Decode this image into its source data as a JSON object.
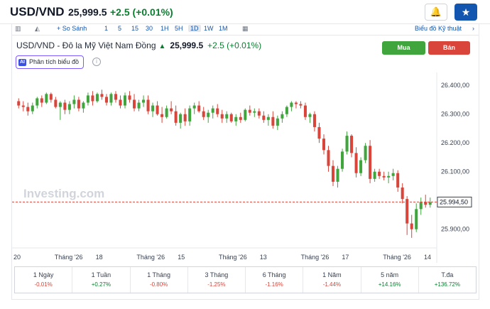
{
  "header": {
    "symbol": "USD/VND",
    "price": "25,999.5",
    "change": "+2.5 (+0.01%)",
    "bell_icon": "bell-plus-icon",
    "star_icon": "star-icon"
  },
  "toolbar": {
    "compare": "+ So Sánh",
    "ranges": [
      "1",
      "5",
      "15",
      "30",
      "1H",
      "5H",
      "1D",
      "1W",
      "1M"
    ],
    "selected": "1D",
    "technical_link": "Biểu đồ Kỹ thuật",
    "chevron": "›"
  },
  "title": {
    "name": "USD/VND - Đô la Mỹ Việt Nam Đồng",
    "arrow": "▲",
    "price": "25,999.5",
    "change": "+2.5 (+0.01%)"
  },
  "actions": {
    "buy": "Mua",
    "sell": "Bán"
  },
  "ai": {
    "badge": "AI",
    "label": "Phân tích biểu đồ",
    "info": "i"
  },
  "chart": {
    "watermark": "Investing.com",
    "current_label": "25.994,50",
    "colors": {
      "up": "#3fa53c",
      "down": "#d9453a",
      "line": "#d9453a"
    }
  },
  "chart_data": {
    "type": "candlestick",
    "current": 25994.5,
    "yticks": [
      26400,
      26300,
      26200,
      26100,
      25900
    ],
    "ytick_labels": [
      "26.400,00",
      "26.300,00",
      "26.200,00",
      "26.100,00",
      "25.900,00"
    ],
    "ylim": [
      25840,
      26440
    ],
    "x_labels": [
      "20",
      "Tháng '26",
      "18",
      "Tháng '26",
      "15",
      "Tháng '26",
      "13",
      "Tháng '26",
      "17",
      "Tháng '26",
      "14"
    ],
    "candles": [
      [
        26345,
        26355,
        26320,
        26330
      ],
      [
        26330,
        26345,
        26310,
        26325
      ],
      [
        26325,
        26340,
        26295,
        26310
      ],
      [
        26310,
        26340,
        26300,
        26330
      ],
      [
        26330,
        26360,
        26320,
        26355
      ],
      [
        26355,
        26365,
        26325,
        26340
      ],
      [
        26340,
        26375,
        26335,
        26370
      ],
      [
        26370,
        26375,
        26340,
        26350
      ],
      [
        26350,
        26360,
        26320,
        26325
      ],
      [
        26325,
        26345,
        26280,
        26340
      ],
      [
        26340,
        26350,
        26300,
        26315
      ],
      [
        26315,
        26345,
        26300,
        26335
      ],
      [
        26335,
        26365,
        26320,
        26350
      ],
      [
        26350,
        26360,
        26310,
        26320
      ],
      [
        26320,
        26345,
        26305,
        26340
      ],
      [
        26340,
        26375,
        26330,
        26365
      ],
      [
        26365,
        26380,
        26330,
        26345
      ],
      [
        26345,
        26375,
        26340,
        26370
      ],
      [
        26370,
        26385,
        26350,
        26360
      ],
      [
        26360,
        26370,
        26330,
        26340
      ],
      [
        26340,
        26375,
        26330,
        26370
      ],
      [
        26370,
        26380,
        26340,
        26350
      ],
      [
        26350,
        26365,
        26320,
        26330
      ],
      [
        26330,
        26375,
        26320,
        26365
      ],
      [
        26365,
        26380,
        26340,
        26350
      ],
      [
        26350,
        26370,
        26310,
        26320
      ],
      [
        26320,
        26350,
        26310,
        26340
      ],
      [
        26340,
        26365,
        26325,
        26350
      ],
      [
        26350,
        26365,
        26300,
        26310
      ],
      [
        26310,
        26340,
        26290,
        26330
      ],
      [
        26330,
        26345,
        26295,
        26300
      ],
      [
        26300,
        26325,
        26270,
        26290
      ],
      [
        26290,
        26330,
        26285,
        26320
      ],
      [
        26320,
        26345,
        26300,
        26310
      ],
      [
        26310,
        26330,
        26260,
        26270
      ],
      [
        26270,
        26305,
        26250,
        26300
      ],
      [
        26300,
        26320,
        26260,
        26275
      ],
      [
        26275,
        26330,
        26260,
        26320
      ],
      [
        26320,
        26340,
        26300,
        26330
      ],
      [
        26330,
        26345,
        26305,
        26310
      ],
      [
        26310,
        26325,
        26280,
        26290
      ],
      [
        26290,
        26315,
        26270,
        26305
      ],
      [
        26305,
        26330,
        26285,
        26320
      ],
      [
        26320,
        26335,
        26290,
        26300
      ],
      [
        26300,
        26315,
        26270,
        26285
      ],
      [
        26285,
        26310,
        26270,
        26300
      ],
      [
        26300,
        26305,
        26270,
        26275
      ],
      [
        26275,
        26300,
        26260,
        26290
      ],
      [
        26290,
        26305,
        26270,
        26280
      ],
      [
        26280,
        26320,
        26275,
        26315
      ],
      [
        26315,
        26330,
        26295,
        26305
      ],
      [
        26305,
        26320,
        26290,
        26310
      ],
      [
        26310,
        26320,
        26285,
        26295
      ],
      [
        26295,
        26310,
        26270,
        26280
      ],
      [
        26280,
        26300,
        26260,
        26290
      ],
      [
        26290,
        26310,
        26250,
        26260
      ],
      [
        26260,
        26295,
        26245,
        26285
      ],
      [
        26285,
        26310,
        26270,
        26300
      ],
      [
        26300,
        26330,
        26290,
        26325
      ],
      [
        26325,
        26345,
        26310,
        26340
      ],
      [
        26340,
        26345,
        26320,
        26335
      ],
      [
        26335,
        26345,
        26320,
        26330
      ],
      [
        26330,
        26340,
        26280,
        26290
      ],
      [
        26290,
        26305,
        26270,
        26300
      ],
      [
        26300,
        26310,
        26240,
        26255
      ],
      [
        26255,
        26270,
        26200,
        26215
      ],
      [
        26215,
        26230,
        26160,
        26175
      ],
      [
        26175,
        26190,
        26100,
        26120
      ],
      [
        26120,
        26140,
        26050,
        26065
      ],
      [
        26065,
        26120,
        26045,
        26110
      ],
      [
        26110,
        26180,
        26100,
        26170
      ],
      [
        26170,
        26240,
        26160,
        26225
      ],
      [
        26225,
        26230,
        26150,
        26165
      ],
      [
        26165,
        26185,
        26080,
        26095
      ],
      [
        26095,
        26150,
        26085,
        26140
      ],
      [
        26140,
        26200,
        26130,
        26190
      ],
      [
        26190,
        26210,
        26060,
        26075
      ],
      [
        26075,
        26110,
        26065,
        26100
      ],
      [
        26100,
        26110,
        26075,
        26085
      ],
      [
        26085,
        26100,
        26070,
        26080
      ],
      [
        26080,
        26100,
        26060,
        26085
      ],
      [
        26085,
        26110,
        26070,
        26095
      ],
      [
        26095,
        26105,
        26030,
        26045
      ],
      [
        26045,
        26060,
        25990,
        26005
      ],
      [
        26005,
        26015,
        25880,
        25920
      ],
      [
        25920,
        25950,
        25870,
        25900
      ],
      [
        25900,
        25990,
        25890,
        25970
      ],
      [
        25970,
        26010,
        25950,
        25995
      ],
      [
        25995,
        26020,
        25975,
        25985
      ],
      [
        25985,
        26010,
        25975,
        25994
      ]
    ]
  },
  "performance": [
    {
      "label": "1 Ngày",
      "value": "-0.01%",
      "dir": "neg"
    },
    {
      "label": "1 Tuần",
      "value": "+0.27%",
      "dir": "pos"
    },
    {
      "label": "1 Tháng",
      "value": "-0.80%",
      "dir": "neg"
    },
    {
      "label": "3 Tháng",
      "value": "-1.25%",
      "dir": "neg"
    },
    {
      "label": "6 Tháng",
      "value": "-1.16%",
      "dir": "neg"
    },
    {
      "label": "1 Năm",
      "value": "-1.44%",
      "dir": "neg"
    },
    {
      "label": "5 năm",
      "value": "+14.16%",
      "dir": "pos"
    },
    {
      "label": "T.đa",
      "value": "+136.72%",
      "dir": "pos"
    }
  ]
}
